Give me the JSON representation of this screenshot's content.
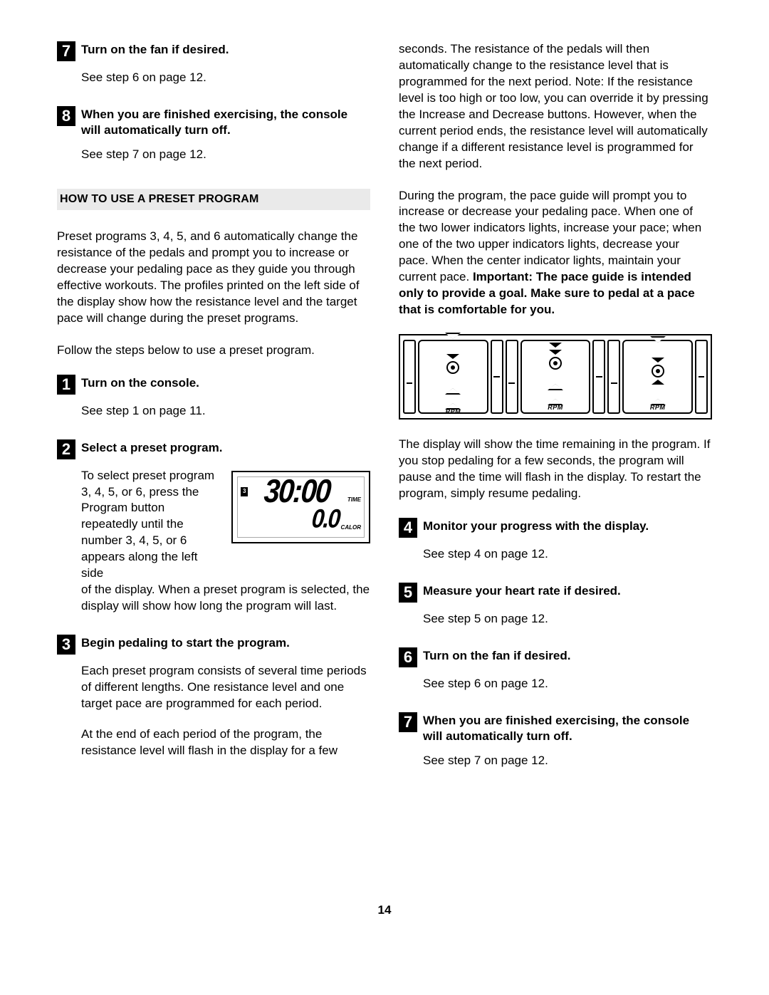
{
  "left": {
    "step7": {
      "num": "7",
      "title": "Turn on the fan if desired.",
      "body": "See step 6 on page 12."
    },
    "step8": {
      "num": "8",
      "title": "When you are finished exercising, the console will automatically turn off.",
      "body": "See step 7 on page 12."
    },
    "section_heading": "HOW TO USE A PRESET PROGRAM",
    "intro1": "Preset programs 3, 4, 5, and 6 automatically change the resistance of the pedals and prompt you to increase or decrease your pedaling pace as they guide you through effective workouts. The profiles printed on the left side of the display show how the resistance level and the target pace will change during the preset programs.",
    "intro2": "Follow the steps below to use a preset program.",
    "s1": {
      "num": "1",
      "title": "Turn on the console.",
      "body": "See step 1 on page 11."
    },
    "s2": {
      "num": "2",
      "title": "Select a preset program.",
      "body_a": "To select preset program 3, 4, 5, or 6, press the Program button repeatedly until the number 3, 4, 5, or 6 appears along the left side",
      "body_b": "of the display. When a preset program is selected, the display will show how long the program will last.",
      "lcd": {
        "badge": "3",
        "time_val": "30:00",
        "time_label": "TIME",
        "cal_val": "0.0",
        "cal_label": "CALOR"
      }
    },
    "s3": {
      "num": "3",
      "title": "Begin pedaling to start the program.",
      "body1": "Each preset program consists of several time periods of different lengths. One resistance level and one target pace are programmed for each period.",
      "body2": "At the end of each period of the program, the resistance level will flash in the display for a few"
    }
  },
  "right": {
    "cont1": "seconds. The resistance of the pedals will then automatically change to the resistance level that is programmed for the next period. Note: If the resistance level is too high or too low, you can override it by pressing the Increase and Decrease buttons. However, when the current period ends, the resistance level will automatically change if a different resistance level is programmed for the next period.",
    "cont2a": "During the program, the pace guide will prompt you to increase or decrease your pedaling pace. When one of the two lower indicators lights, increase your pace; when one of the two upper indicators lights, decrease your pace. When the center indicator lights, maintain your current pace. ",
    "cont2b": "Important: The pace guide is intended only to provide a goal. Make sure to pedal at a pace that is comfortable for you.",
    "rpm_label": "RPM",
    "cont3": "The display will show the time remaining in the program. If you stop pedaling for a few seconds, the program will pause and the time will flash in the display. To restart the program, simply resume pedaling.",
    "s4": {
      "num": "4",
      "title": "Monitor your progress with the display.",
      "body": "See step 4 on page 12."
    },
    "s5": {
      "num": "5",
      "title": "Measure your heart rate if desired.",
      "body": "See step 5 on page 12."
    },
    "s6": {
      "num": "6",
      "title": "Turn on the fan if desired.",
      "body": "See step 6 on page 12."
    },
    "s7": {
      "num": "7",
      "title": "When you are finished exercising, the console will automatically turn off.",
      "body": "See step 7 on page 12."
    }
  },
  "page_number": "14"
}
